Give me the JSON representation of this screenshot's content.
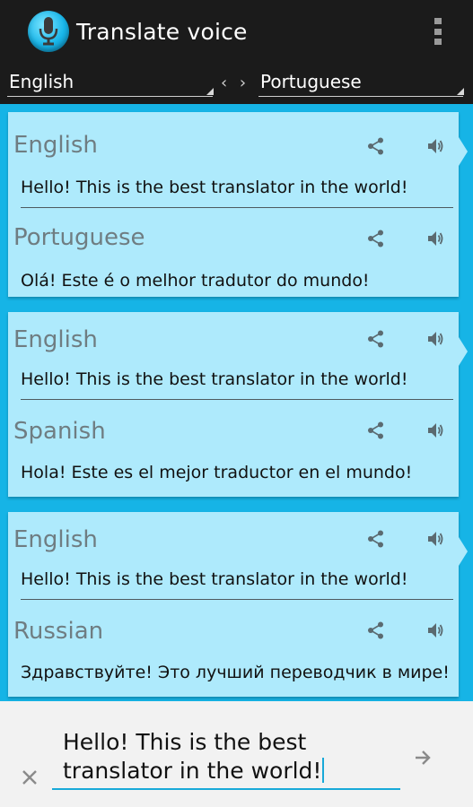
{
  "app": {
    "title": "Translate voice"
  },
  "languages": {
    "source": "English",
    "target": "Portuguese",
    "swap": "‹ ›"
  },
  "cards": [
    {
      "source_lang": "English",
      "source_text": "Hello! This is the best translator in the world!",
      "target_lang": "Portuguese",
      "target_text": "Olá! Este é o melhor tradutor do mundo!"
    },
    {
      "source_lang": "English",
      "source_text": "Hello! This is the best translator in the world!",
      "target_lang": "Spanish",
      "target_text": "Hola! Este es el mejor traductor en el mundo!"
    },
    {
      "source_lang": "English",
      "source_text": "Hello! This is the best translator in the world!",
      "target_lang": "Russian",
      "target_text": "Здравствуйте! Это лучший переводчик в мире!"
    }
  ],
  "input": {
    "text": "Hello! This is the best translator in the world!"
  },
  "icons": {
    "app": "microphone-icon",
    "menu": "overflow-menu-icon",
    "share": "share-icon",
    "speaker": "speaker-icon",
    "clear": "close-icon",
    "send": "arrow-right-icon"
  },
  "colors": {
    "accent": "#16b4e6",
    "card": "#aeeafc",
    "bar": "#1b1b1b"
  }
}
